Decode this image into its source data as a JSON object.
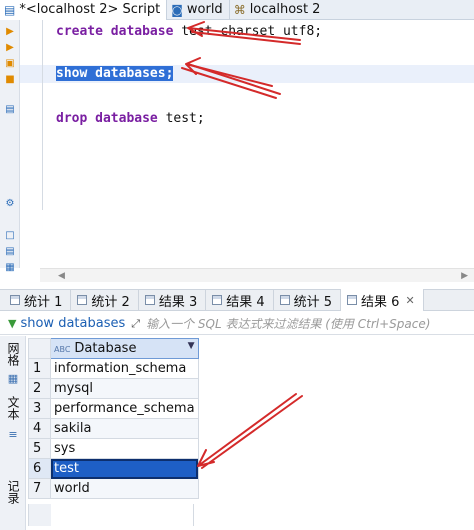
{
  "editor_tabs": [
    {
      "label": "*<localhost 2> Script"
    },
    {
      "label": "world"
    },
    {
      "label": "localhost 2"
    }
  ],
  "editor": {
    "line1": {
      "kw": "create database",
      "rest": " test charset utf8;"
    },
    "line2": {
      "selected": "show databases;"
    },
    "line3": {
      "kw": "drop database",
      "rest": " test;"
    }
  },
  "result_tabs": [
    {
      "label": "统计 1"
    },
    {
      "label": "统计 2"
    },
    {
      "label": "结果 3"
    },
    {
      "label": "结果 4"
    },
    {
      "label": "统计 5"
    },
    {
      "label": "结果 6"
    }
  ],
  "filter": {
    "query_label": "show databases",
    "placeholder": "输入一个 SQL 表达式来过滤结果 (使用 Ctrl+Space)"
  },
  "side_labels": {
    "grid": "网格",
    "text": "文本",
    "record": "记录"
  },
  "grid": {
    "column": "Database",
    "rows": [
      {
        "n": "1",
        "v": "information_schema"
      },
      {
        "n": "2",
        "v": "mysql"
      },
      {
        "n": "3",
        "v": "performance_schema"
      },
      {
        "n": "4",
        "v": "sakila"
      },
      {
        "n": "5",
        "v": "sys"
      },
      {
        "n": "6",
        "v": "test"
      },
      {
        "n": "7",
        "v": "world"
      }
    ]
  },
  "colors": {
    "annotation": "#d42a2a",
    "selection": "#2f6fd6"
  }
}
